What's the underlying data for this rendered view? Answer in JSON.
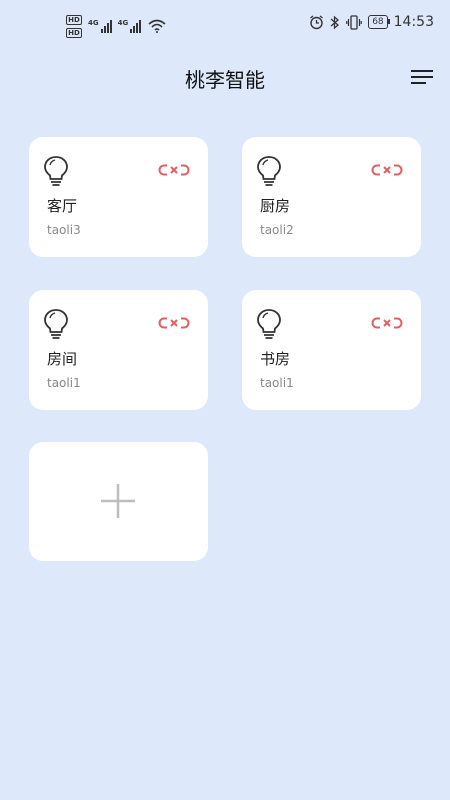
{
  "status_bar": {
    "network_tag_1": "4G",
    "network_tag_2": "4G",
    "battery": "68",
    "time": "14:53"
  },
  "header": {
    "title": "桃李智能"
  },
  "devices": [
    {
      "room": "客厅",
      "device_id": "taoli3"
    },
    {
      "room": "厨房",
      "device_id": "taoli2"
    },
    {
      "room": "房间",
      "device_id": "taoli1"
    },
    {
      "room": "书房",
      "device_id": "taoli1"
    }
  ],
  "icons": {
    "device_icon": "lightbulb-icon",
    "status_icon": "disconnected-link-icon",
    "add_icon": "plus-icon",
    "menu_icon": "menu-icon"
  },
  "colors": {
    "background": "#dde9fb",
    "card": "#ffffff",
    "disconnected": "#e06060"
  }
}
